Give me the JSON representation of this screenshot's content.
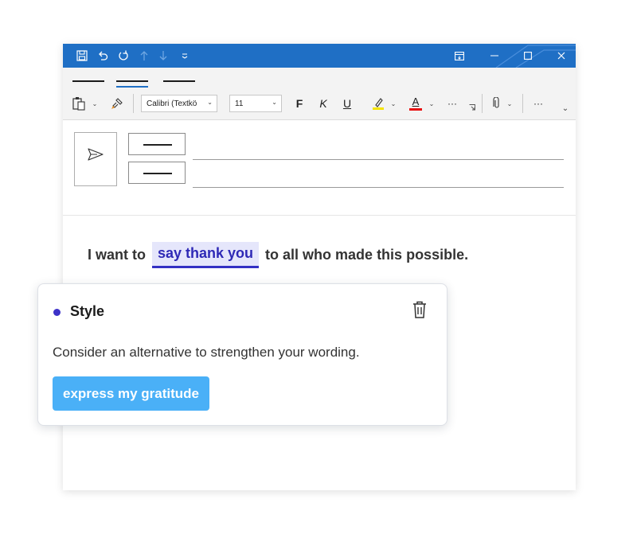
{
  "ribbon": {
    "font_name": "Calibri (Textkö",
    "font_size": "11",
    "bold_label": "F",
    "italic_label": "K",
    "underline_label": "U",
    "font_color_label": "A",
    "more_label": "···"
  },
  "editor": {
    "text_before": "I want to",
    "highlighted": "say thank you",
    "text_after": "to all who made this possible."
  },
  "suggestion_card": {
    "category": "Style",
    "message": "Consider an alternative to strengthen your wording.",
    "suggestion": "express my gratitude"
  },
  "colors": {
    "titlebar": "#1f6fc5",
    "highlight_bg": "#e5e6fb",
    "highlight_text": "#2e29b6",
    "dot": "#3d32c8",
    "suggestion_btn": "#4ab0f7",
    "highlighter_yellow": "#f5e400",
    "font_red": "#e81010"
  }
}
